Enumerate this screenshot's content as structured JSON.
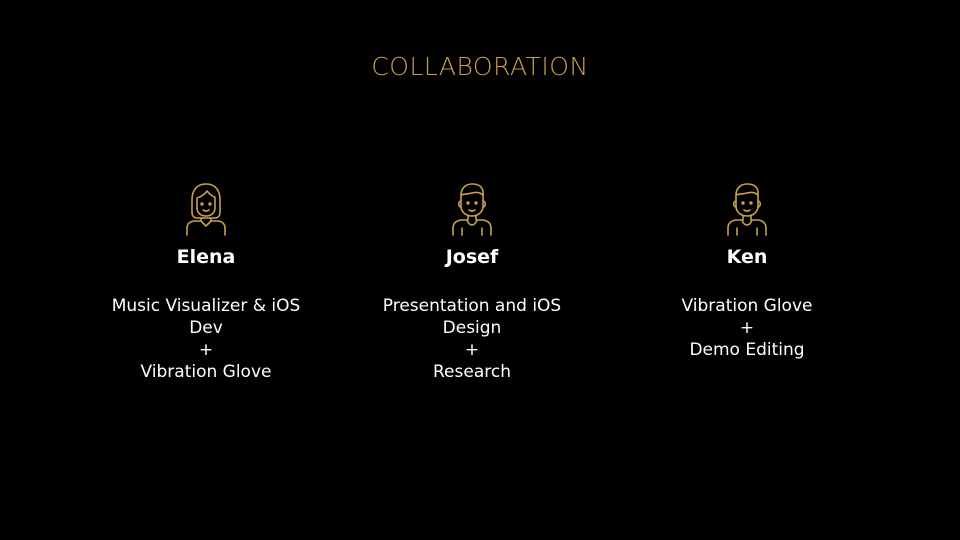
{
  "slide": {
    "title": "COLLABORATION",
    "accent_color": "#c9a04b",
    "members": [
      {
        "avatar_icon": "woman-avatar-icon",
        "name": "Elena",
        "role_lines": [
          "Music Visualizer & iOS",
          "Dev",
          "+",
          "Vibration Glove"
        ]
      },
      {
        "avatar_icon": "man-avatar-icon",
        "name": "Josef",
        "role_lines": [
          "Presentation and iOS",
          "Design",
          "+",
          "Research"
        ]
      },
      {
        "avatar_icon": "man-avatar-icon",
        "name": "Ken",
        "role_lines": [
          "Vibration Glove",
          "+",
          "Demo Editing"
        ]
      }
    ]
  }
}
